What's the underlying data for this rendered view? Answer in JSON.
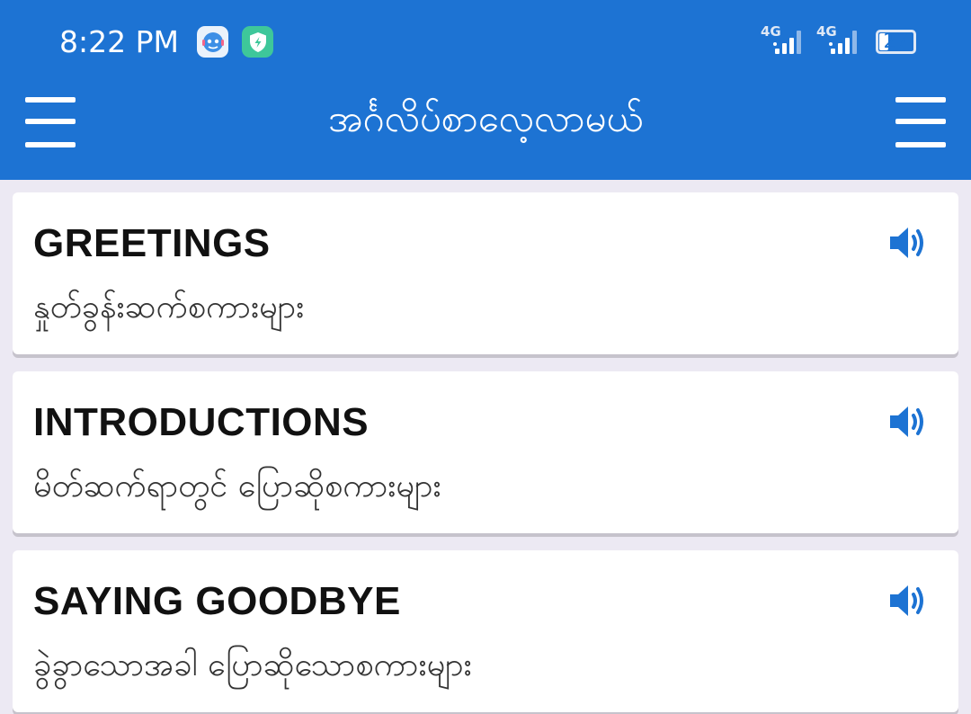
{
  "status_bar": {
    "time": "8:22 PM",
    "signal_1_label": "4G",
    "signal_2_label": "4G",
    "battery_level": "27",
    "battery_fraction": 0.27
  },
  "app_bar": {
    "title": "အင်္ဂလိပ်စာလေ့လာမယ်",
    "left_icon": "menu-icon",
    "right_icon": "menu-icon",
    "background_color": "#1d73d3"
  },
  "cards": [
    {
      "title": "GREETINGS",
      "subtitle": "နှုတ်ခွန်းဆက်စကားများ",
      "icon": "speaker-icon"
    },
    {
      "title": "INTRODUCTIONS",
      "subtitle": "မိတ်ဆက်ရာတွင် ပြောဆိုစကားများ",
      "icon": "speaker-icon"
    },
    {
      "title": "SAYING GOODBYE",
      "subtitle": "ခွဲခွာသောအခါ ပြောဆိုသောစကားများ",
      "icon": "speaker-icon"
    }
  ],
  "colors": {
    "accent": "#1d73d3",
    "page_background": "#ece9f3",
    "card_background": "#ffffff"
  }
}
